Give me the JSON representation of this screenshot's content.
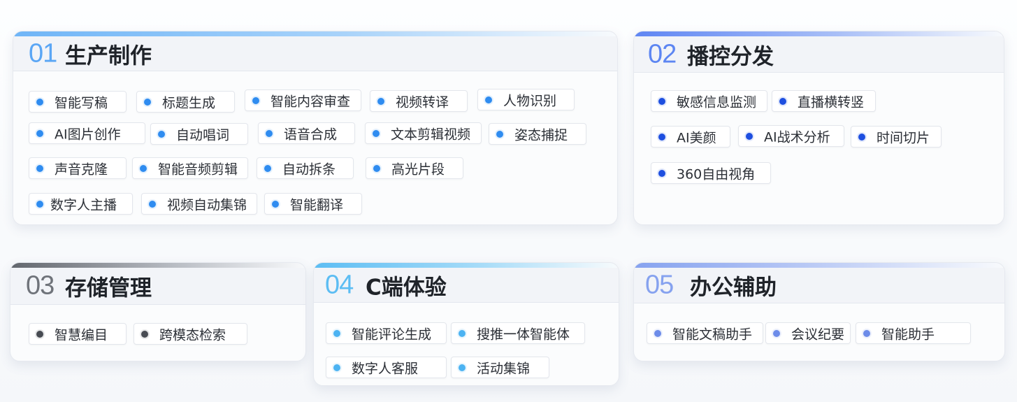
{
  "theme": {
    "blue": "#2f8cf0",
    "navy": "#1e4fe0",
    "gray": "#474b52",
    "sky": "#4cb3f2",
    "periwinkle": "#6d8ce9"
  },
  "sections": [
    {
      "number": "01",
      "title": "生产制作",
      "num_color": "#5aa6f5",
      "dot_color": "#2f8cf0",
      "tags": [
        "智能写稿",
        "标题生成",
        "智能内容审查",
        "视频转译",
        "人物识别",
        "AI图片创作",
        "自动唱词",
        "语音合成",
        "文本剪辑视频",
        "姿态捕捉",
        "声音克隆",
        "智能音频剪辑",
        "自动拆条",
        "高光片段",
        "数字人主播",
        "视频自动集锦",
        "智能翻译"
      ]
    },
    {
      "number": "02",
      "title": "播控分发",
      "num_color": "#5d86f2",
      "dot_color": "#1e4fe0",
      "tags": [
        "敏感信息监测",
        "直播横转竖",
        "AI美颜",
        "AI战术分析",
        "时间切片",
        "360自由视角"
      ]
    },
    {
      "number": "03",
      "title": "存储管理",
      "num_color": "#6f737a",
      "dot_color": "#474b52",
      "tags": [
        "智慧编目",
        "跨模态检索"
      ]
    },
    {
      "number": "04",
      "title": "C端体验",
      "num_color": "#5cbdf3",
      "dot_color": "#4cb3f2",
      "tags": [
        "智能评论生成",
        "搜推一体智能体",
        "数字人客服",
        "活动集锦"
      ]
    },
    {
      "number": "05",
      "title": "办公辅助",
      "num_color": "#86a2ef",
      "dot_color": "#6d8ce9",
      "tags": [
        "智能文稿助手",
        "会议纪要",
        "智能助手"
      ]
    }
  ]
}
